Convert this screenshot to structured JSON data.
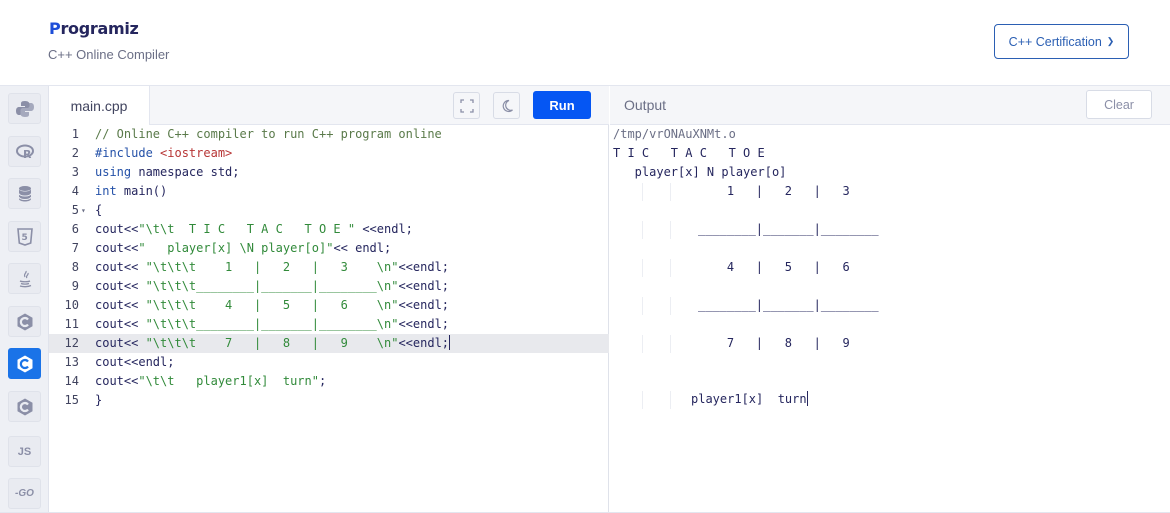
{
  "header": {
    "logo_text": "rogramiz",
    "logo_initial": "P",
    "subtitle": "C++ Online Compiler",
    "cert_button": "C++ Certification",
    "cert_arrow": "❯"
  },
  "sidebar": {
    "items": [
      {
        "name": "python",
        "icon": "python-icon"
      },
      {
        "name": "r",
        "icon": "r-icon"
      },
      {
        "name": "sql",
        "icon": "database-icon"
      },
      {
        "name": "html",
        "icon": "html5-icon"
      },
      {
        "name": "java",
        "icon": "java-icon"
      },
      {
        "name": "c",
        "icon": "c-icon"
      },
      {
        "name": "cpp",
        "icon": "cpp-icon",
        "active": true
      },
      {
        "name": "csharp",
        "icon": "csharp-icon"
      },
      {
        "name": "js",
        "icon": "js-icon",
        "label": "JS"
      },
      {
        "name": "go",
        "icon": "go-icon",
        "label": "-GO"
      }
    ]
  },
  "editor": {
    "file_tab": "main.cpp",
    "run_label": "Run",
    "lines": [
      "1",
      "2",
      "3",
      "4",
      "5",
      "6",
      "7",
      "8",
      "9",
      "10",
      "11",
      "12",
      "13",
      "14",
      "15"
    ],
    "code": {
      "l1": "// Online C++ compiler to run C++ program online",
      "l2_kw": "#include",
      "l2_inc": " <iostream>",
      "l3_kw": "using",
      "l3_rest": " namespace std;",
      "l4_kw": "int",
      "l4_rest": " main()",
      "l5": "{",
      "l6_a": "cout<<",
      "l6_str": "\"\\t\\t  T I C   T A C   T O E \"",
      "l6_b": " <<endl;",
      "l7_a": "cout<<",
      "l7_str": "\"   player[x] \\N player[o]\"",
      "l7_b": "<< endl;",
      "l8_a": "cout<< ",
      "l8_str": "\"\\t\\t\\t    1   |   2   |   3    \\n\"",
      "l8_b": "<<endl;",
      "l9_a": "cout<< ",
      "l9_str": "\"\\t\\t\\t________|_______|________\\n\"",
      "l9_b": "<<endl;",
      "l10_a": "cout<< ",
      "l10_str": "\"\\t\\t\\t    4   |   5   |   6    \\n\"",
      "l10_b": "<<endl;",
      "l11_a": "cout<< ",
      "l11_str": "\"\\t\\t\\t________|_______|________\\n\"",
      "l11_b": "<<endl;",
      "l12_a": "cout<< ",
      "l12_str": "\"\\t\\t\\t    7   |   8   |   9    \\n\"",
      "l12_b": "<<endl;",
      "l13": "cout<<endl;",
      "l14_a": "cout<<",
      "l14_str": "\"\\t\\t   player1[x]  turn\"",
      "l14_b": ";",
      "l15": "}"
    }
  },
  "output": {
    "title": "Output",
    "clear_label": "Clear",
    "path": "/tmp/vrONAuXNMt.o",
    "lines": {
      "o1": "T I C   T A C   T O E",
      "o2": "   player[x] N player[o]",
      "o3": "    1   |   2   |   3",
      "o4": "________|_______|________",
      "o5": "    4   |   5   |   6",
      "o6": "________|_______|________",
      "o7": "    7   |   8   |   9",
      "o8": "player1[x]  turn"
    }
  }
}
